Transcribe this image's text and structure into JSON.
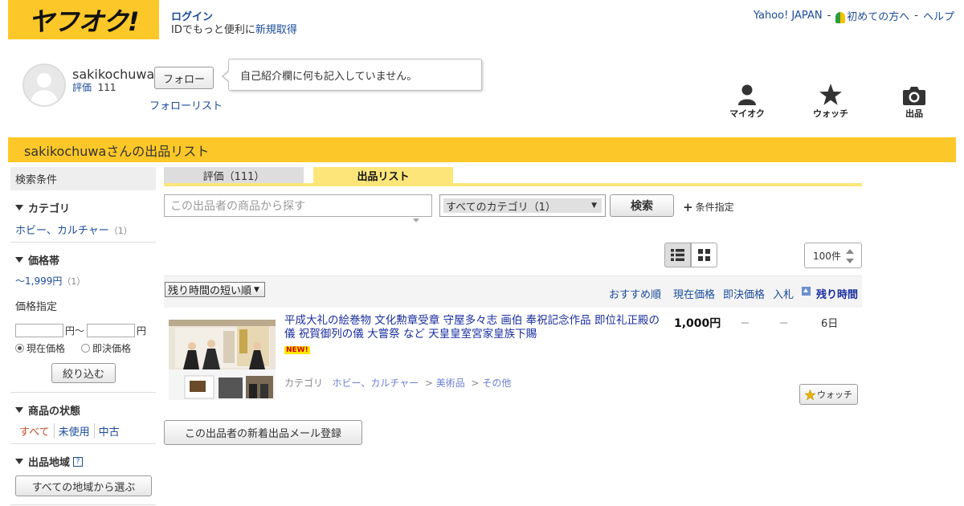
{
  "header": {
    "logo_text": "ヤフオク!",
    "login": "ログイン",
    "id_text": "IDでもっと便利に",
    "register": "新規取得",
    "links": [
      "Yahoo! JAPAN",
      "初めての方へ",
      "ヘルプ"
    ],
    "sep": "-"
  },
  "profile": {
    "username": "sakikochuwa",
    "rating_label": "評価",
    "rating_value": "111",
    "follow_button": "フォロー",
    "follow_list": "フォローリスト",
    "bio": "自己紹介欄に何も記入していません。"
  },
  "quick_nav": {
    "myauc": "マイオク",
    "watch": "ウォッチ",
    "sell": "出品"
  },
  "title_bar": "sakikochuwaさんの出品リスト",
  "sidebar": {
    "heading": "検索条件",
    "category": {
      "label": "カテゴリ",
      "item": "ホビー、カルチャー",
      "count": "（1）"
    },
    "price": {
      "label": "価格帯",
      "item": "〜1,999円",
      "count": "（1）",
      "specify": "価格指定",
      "yen_range": "円～",
      "yen": "円",
      "radio_current": "現在価格",
      "radio_buynow": "即決価格",
      "filter_button": "絞り込む"
    },
    "condition": {
      "label": "商品の状態",
      "options": [
        "すべて",
        "未使用",
        "中古"
      ]
    },
    "region": {
      "label": "出品地域",
      "help": "?",
      "button": "すべての地域から選ぶ"
    }
  },
  "tabs": {
    "rating": "評価（111）",
    "list": "出品リスト"
  },
  "search": {
    "placeholder": "この出品者の商品から探す",
    "category_select": "すべてのカテゴリ（1）",
    "button": "検索",
    "condition": "条件指定"
  },
  "per_page": "100件",
  "sort": {
    "select": "残り時間の短い順",
    "columns": [
      "おすすめ順",
      "現在価格",
      "即決価格",
      "入札",
      "残り時間"
    ]
  },
  "item": {
    "title": "平成大礼の絵巻物 文化勲章受章 守屋多々志 画伯 奉祝記念作品 即位礼正殿の儀 祝賀御列の儀 大嘗祭 など 天皇皇室宮家皇族下賜",
    "badge": "NEW!",
    "category_label": "カテゴリ",
    "category_path": [
      "ホビー、カルチャー",
      "美術品",
      "その他"
    ],
    "current_price": "1,000円",
    "buynow_price": "－",
    "bids": "－",
    "remaining": "6日",
    "watch_button": "ウォッチ"
  },
  "mail_button": "この出品者の新着出品メール登録",
  "colors": {
    "brand_yellow": "#fcc728",
    "tab_yellow": "#fde57a",
    "link_blue": "#1a4b9c"
  }
}
